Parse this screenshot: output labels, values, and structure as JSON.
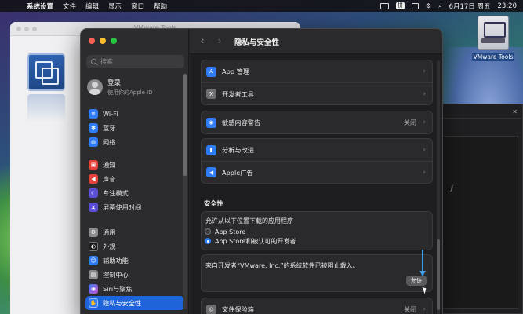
{
  "menubar": {
    "apple": "",
    "items": [
      "系统设置",
      "文件",
      "编辑",
      "显示",
      "窗口",
      "帮助"
    ],
    "input_badge": "拼",
    "datetime": "6月17日 周五",
    "time": "23:20"
  },
  "desktop": {
    "icon_label": "VMware Tools"
  },
  "sidebar": {
    "search_placeholder": "搜索",
    "account": {
      "title": "登录",
      "subtitle": "使用你的Apple ID"
    },
    "group1": [
      {
        "label": "Wi-Fi",
        "icon": "wifi-icon",
        "color": "#2f7cf6",
        "glyph": "≋"
      },
      {
        "label": "蓝牙",
        "icon": "bluetooth-icon",
        "color": "#2f7cf6",
        "glyph": "✱"
      },
      {
        "label": "网络",
        "icon": "globe-icon",
        "color": "#2f7cf6",
        "glyph": "◍"
      }
    ],
    "group2": [
      {
        "label": "通知",
        "icon": "notification-icon",
        "color": "#e5403a",
        "glyph": "▣"
      },
      {
        "label": "声音",
        "icon": "sound-icon",
        "color": "#e5403a",
        "glyph": "◀"
      },
      {
        "label": "专注模式",
        "icon": "moon-icon",
        "color": "#5b4fd6",
        "glyph": "☾"
      },
      {
        "label": "屏幕使用时间",
        "icon": "hourglass-icon",
        "color": "#5b4fd6",
        "glyph": "⧗"
      }
    ],
    "group3": [
      {
        "label": "通用",
        "icon": "gear-icon",
        "color": "#8a8a8e",
        "glyph": "⚙"
      },
      {
        "label": "外观",
        "icon": "appearance-icon",
        "color": "#1c1c1e",
        "glyph": "◐"
      },
      {
        "label": "辅助功能",
        "icon": "accessibility-icon",
        "color": "#2f7cf6",
        "glyph": "☺"
      },
      {
        "label": "控制中心",
        "icon": "control-center-icon",
        "color": "#8a8a8e",
        "glyph": "▤"
      },
      {
        "label": "Siri与聚焦",
        "icon": "siri-icon",
        "color": "#b04fd6",
        "glyph": "◉"
      },
      {
        "label": "隐私与安全性",
        "icon": "hand-icon",
        "color": "#2f7cf6",
        "glyph": "✋",
        "selected": true
      }
    ]
  },
  "content": {
    "title": "隐私与安全性",
    "groupA": [
      {
        "label": "App 管理",
        "icon": "app-store-icon",
        "color": "#2f7cf6",
        "glyph": "A"
      },
      {
        "label": "开发者工具",
        "icon": "hammer-icon",
        "color": "#6e6e72",
        "glyph": "⚒"
      }
    ],
    "groupB": [
      {
        "label": "敏感内容警告",
        "icon": "eye-icon",
        "color": "#2f7cf6",
        "glyph": "◉",
        "value": "关闭"
      }
    ],
    "groupC": [
      {
        "label": "分析与改进",
        "icon": "chart-icon",
        "color": "#2f7cf6",
        "glyph": "▮"
      },
      {
        "label": "Apple广告",
        "icon": "megaphone-icon",
        "color": "#2f7cf6",
        "glyph": "◀"
      }
    ],
    "security": {
      "heading": "安全性",
      "allow_label": "允许从以下位置下载的应用程序",
      "option1": "App Store",
      "option2": "App Store和被认可的开发者",
      "selected": 2,
      "blocked_message": "来自开发者“VMware, Inc.”的系统软件已被阻止载入。",
      "allow_button": "允许"
    },
    "groupD": [
      {
        "label": "文件保险箱",
        "icon": "vault-icon",
        "color": "#6e6e72",
        "glyph": "◎",
        "value": "关闭"
      }
    ]
  },
  "colors": {
    "accent": "#1f64d8",
    "annotation_arrow": "#3f9ee8"
  }
}
